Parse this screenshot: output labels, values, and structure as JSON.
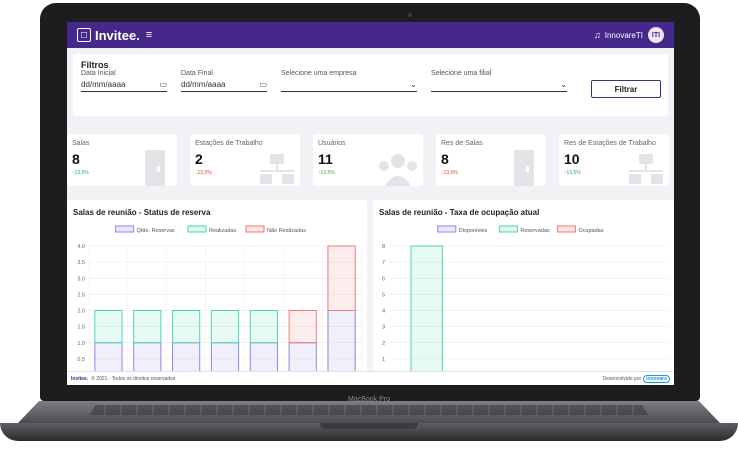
{
  "device": {
    "model": "MacBook Pro"
  },
  "header": {
    "logo_text": "Invitee.",
    "menu_icon": "hamburger-icon",
    "bell_icon": "bell-icon",
    "user_name": "InnovareTI",
    "avatar_text": "ITI"
  },
  "filters": {
    "title": "Filtros",
    "date_start_label": "Data Inicial",
    "date_start_value": "dd/mm/aaaa",
    "date_end_label": "Data Final",
    "date_end_value": "dd/mm/aaaa",
    "company_label": "Selecione uma empresa",
    "branch_label": "Selecione uma filial",
    "filter_button": "Filtrar"
  },
  "stats": [
    {
      "label": "Salas",
      "value": "8",
      "trend": "↑13,5%",
      "direction": "up",
      "icon": "door-icon"
    },
    {
      "label": "Estações de Trabalho",
      "value": "2",
      "trend": "↓13,5%",
      "direction": "down",
      "icon": "network-icon"
    },
    {
      "label": "Usuários",
      "value": "11",
      "trend": "↑13,5%",
      "direction": "up",
      "icon": "users-icon"
    },
    {
      "label": "Res de Salas",
      "value": "8",
      "trend": "↓13,5%",
      "direction": "down",
      "icon": "door-icon"
    },
    {
      "label": "Res de Estações de Trabalho",
      "value": "10",
      "trend": "↑13,5%",
      "direction": "up",
      "icon": "network-icon"
    }
  ],
  "colors": {
    "brand": "#45288a",
    "series_purple": "#8f87e6",
    "series_green": "#4fd6ad",
    "series_red": "#f07a7a",
    "up": "#2ea84f",
    "down": "#d8453b"
  },
  "chart_data": [
    {
      "type": "bar",
      "title": "Salas de reunião - Status de reserva",
      "stacked": true,
      "categories": [
        "",
        "",
        "",
        "",
        "",
        "",
        ""
      ],
      "series": [
        {
          "name": "Qtde. Reservas",
          "values": [
            1,
            1,
            1,
            1,
            1,
            1,
            2
          ]
        },
        {
          "name": "Realizadas",
          "values": [
            1,
            1,
            1,
            1,
            1,
            0,
            0
          ]
        },
        {
          "name": "Não Realizadas",
          "values": [
            0,
            0,
            0,
            0,
            0,
            1,
            2
          ]
        }
      ],
      "yticks": [
        "0.5",
        "1.0",
        "1.5",
        "2.0",
        "2.5",
        "3.0",
        "3.5",
        "4.0"
      ],
      "ylim": [
        0,
        4
      ],
      "legend": "top",
      "grid": true
    },
    {
      "type": "bar",
      "title": "Salas de reunião - Taxa de ocupação atual",
      "categories": [
        ""
      ],
      "series": [
        {
          "name": "Disponíveis",
          "values": [
            8
          ]
        },
        {
          "name": "Reservadas",
          "values": [
            0
          ]
        },
        {
          "name": "Ocupadas",
          "values": [
            0
          ]
        }
      ],
      "yticks": [
        "1",
        "2",
        "3",
        "4",
        "5",
        "6",
        "7",
        "8"
      ],
      "ylim": [
        0,
        8
      ],
      "legend": "top",
      "grid": true
    }
  ],
  "footer": {
    "logo": "Invitee.",
    "copyright": "© 2021 - Todos os direitos reservados",
    "developed_by": "Desenvolvido por",
    "developer": "innovare"
  }
}
